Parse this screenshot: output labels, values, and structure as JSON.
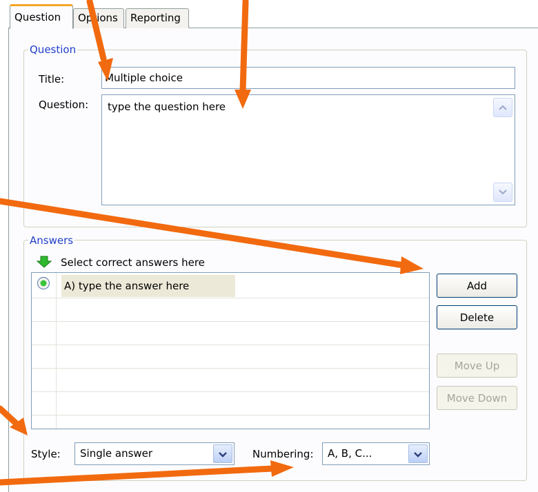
{
  "tabs": [
    {
      "label": "Question"
    },
    {
      "label": "Options"
    },
    {
      "label": "Reporting"
    }
  ],
  "question_group": {
    "legend": "Question",
    "title_label": "Title:",
    "title_value": "Multiple choice",
    "question_label": "Question:",
    "question_value": "type the question here"
  },
  "answers_group": {
    "legend": "Answers",
    "hint": "Select correct answers here",
    "answers": [
      {
        "text": "A) type the answer here",
        "selected": true
      }
    ],
    "buttons": {
      "add": "Add",
      "delete": "Delete",
      "move_up": "Move Up",
      "move_down": "Move Down"
    }
  },
  "style": {
    "label": "Style:",
    "value": "Single answer"
  },
  "numbering": {
    "label": "Numbering:",
    "value": "A, B, C..."
  },
  "colors": {
    "annotation_arrow": "#f26a0f",
    "group_legend": "#1f3ec9",
    "active_tab_accent": "#f5a623"
  },
  "icons": {
    "hint": "green-down-arrow-icon",
    "radio": "radio-selected-icon",
    "scroll_up": "chevron-up-icon",
    "scroll_down": "chevron-down-icon",
    "dropdown": "chevron-down-icon"
  }
}
